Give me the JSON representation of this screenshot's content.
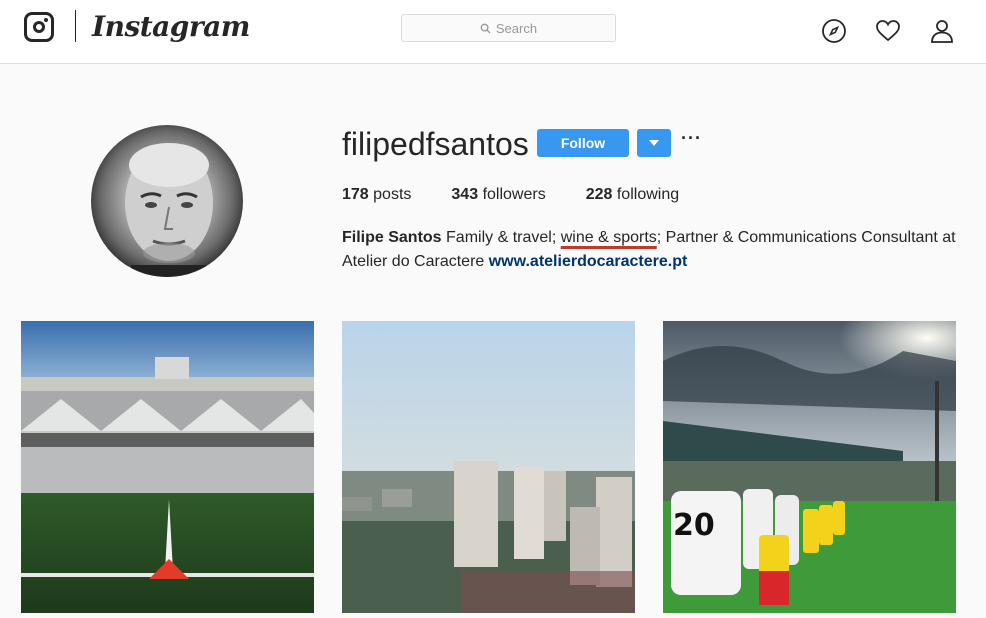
{
  "header": {
    "brand": "Instagram",
    "search_placeholder": "Search",
    "icons": [
      "instagram-logo-icon",
      "search-icon",
      "compass-icon",
      "heart-icon",
      "profile-icon"
    ]
  },
  "profile": {
    "username": "filipedfsantos",
    "follow_label": "Follow",
    "more_label": "···",
    "stats": [
      {
        "count": "178",
        "label": "posts"
      },
      {
        "count": "343",
        "label": "followers"
      },
      {
        "count": "228",
        "label": "following"
      }
    ],
    "bio": {
      "name": "Filipe Santos",
      "text_before": "Family & travel; ",
      "highlight": "wine & sports",
      "text_after": "; Partner & Communications Consultant at Atelier do Caractere ",
      "link": "www.atelierdocaractere.pt"
    }
  },
  "colors": {
    "accent": "#3897f0",
    "link": "#003569",
    "highlight_underline": "#c0392b"
  },
  "posts": [
    {
      "description": "stadium with empty stands and pitch"
    },
    {
      "description": "city skyline with tall buildings"
    },
    {
      "description": "football players lining up on pitch"
    }
  ]
}
